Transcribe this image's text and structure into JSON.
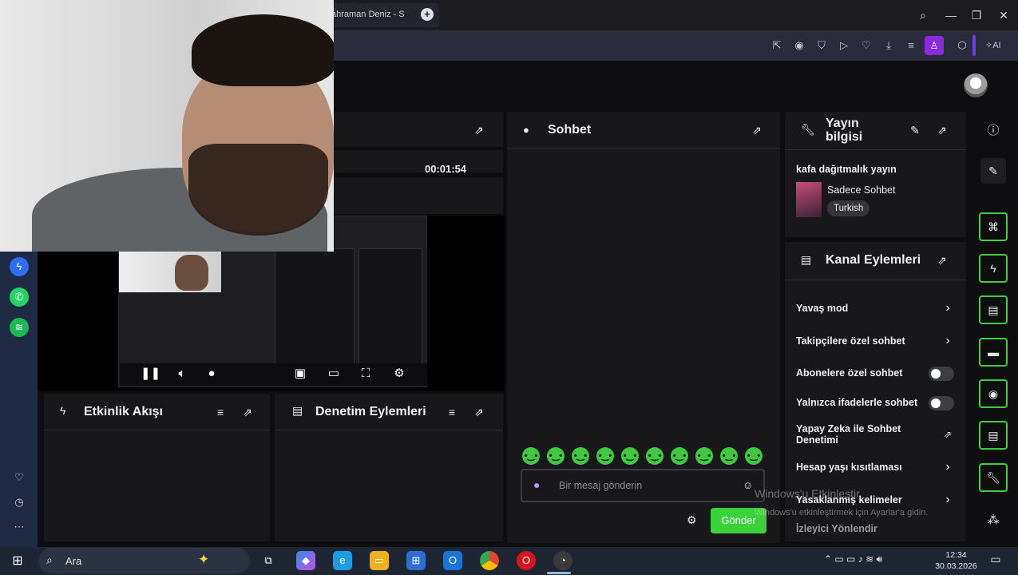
{
  "browser": {
    "tab_title": "ahraman Deniz - S",
    "new_tab": "+",
    "window_controls": {
      "search": "⌕",
      "minimize": "—",
      "restore": "❐",
      "close": "✕"
    },
    "toolbar_icons": [
      "share-icon",
      "camera-icon",
      "shield-icon",
      "play-icon",
      "heart-icon",
      "download-icon",
      "menu-icon",
      "profile-icon",
      "cube-icon"
    ],
    "ai_label": "AI"
  },
  "stream_manager": {
    "timer": "00:01:54",
    "activity_feed": {
      "title": "Etkinlik Akışı"
    },
    "moderation_actions": {
      "title": "Denetim Eylemleri"
    },
    "chat": {
      "title": "Sohbet",
      "input_placeholder": "Bir mesaj gönderin",
      "send_label": "Gönder",
      "emote_count": 10
    },
    "stream_info": {
      "title": "Yayın bilgisi",
      "stream_title": "kafa dağıtmalık yayın",
      "category": "Sadece Sohbet",
      "language_tag": "Turkish"
    },
    "channel_actions": {
      "title": "Kanal Eylemleri",
      "items": [
        {
          "label": "Yavaş mod",
          "control": "chevron"
        },
        {
          "label": "Takipçilere özel sohbet",
          "control": "chevron"
        },
        {
          "label": "Abonelere özel sohbet",
          "control": "toggle"
        },
        {
          "label": "Yalnızca ifadelerle sohbet",
          "control": "toggle"
        },
        {
          "label": "Yapay Zeka ile Sohbet Denetimi",
          "control": "popout"
        },
        {
          "label": "Hesap yaşı kısıtlaması",
          "control": "chevron"
        },
        {
          "label": "Yasaklanmış kelimeler",
          "control": "chevron"
        },
        {
          "label": "İzleyici Yönlendir",
          "control": "none"
        }
      ]
    }
  },
  "windows_watermark": {
    "line1": "Windows'u Etkinleştir",
    "line2": "Windows'u etkinleştirmek için Ayarlar'a gidin."
  },
  "taskbar": {
    "search_placeholder": "Ara",
    "time": "12:34",
    "date": "30.03.2026"
  },
  "colors": {
    "accent": "#3bd13b",
    "panel": "#18181b",
    "bg": "#0e0e10"
  }
}
